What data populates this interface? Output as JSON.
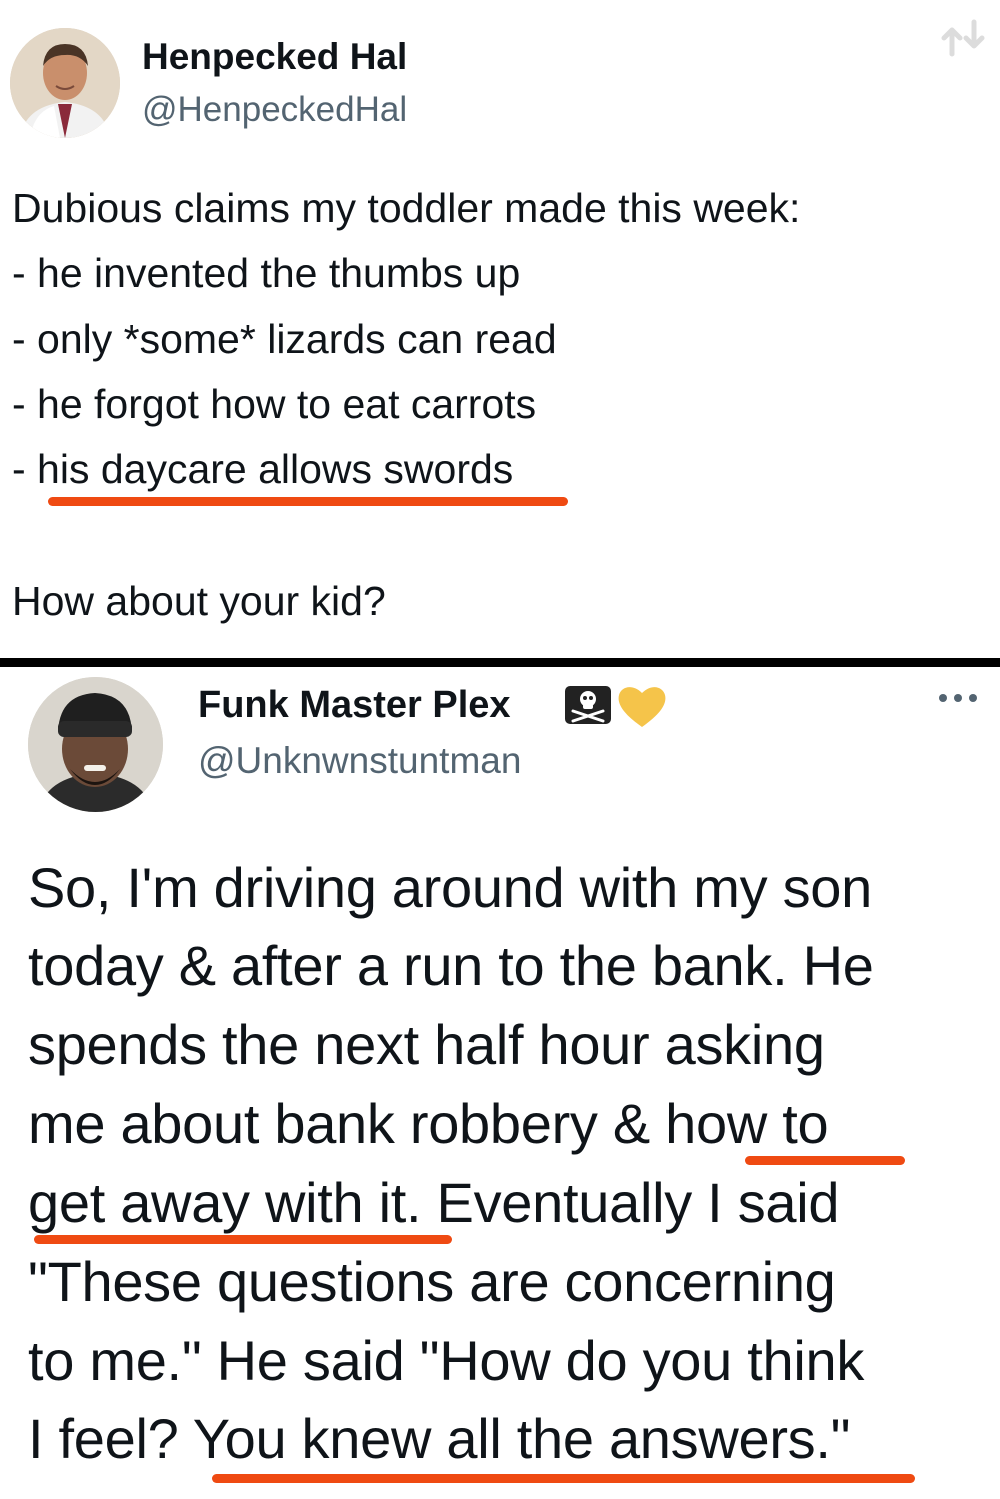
{
  "tweet1": {
    "display_name": "Henpecked Hal",
    "handle": "@HenpeckedHal",
    "lines": [
      "Dubious claims my toddler made this week:",
      "- he invented the thumbs up",
      "- only *some* lizards can read",
      "- he forgot how to eat carrots",
      "- his daycare allows swords"
    ],
    "closing": "How about your kid?"
  },
  "tweet2": {
    "display_name": "Funk Master Plex",
    "handle": "@Unknwnstuntman",
    "badges": [
      "pirate-flag-icon",
      "yellow-heart-icon"
    ],
    "lines": [
      "So, I'm driving around with my son",
      "today & after a run to the bank. He",
      "spends the next half hour asking",
      "me about bank robbery & how to",
      "get away with it. Eventually I said",
      "\"These questions are concerning",
      "to me.\" He said \"How do you think",
      "I feel? You knew all the answers.\""
    ]
  },
  "colors": {
    "underline": "#ef4a12",
    "divider": "#000000",
    "handle": "#536471",
    "heart": "#f5c44a"
  }
}
